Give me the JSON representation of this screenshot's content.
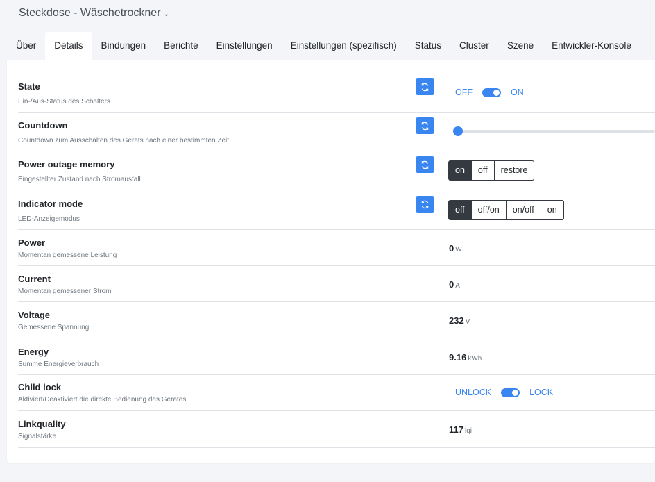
{
  "header": {
    "device_title": "Steckdose - Wäschetrockner"
  },
  "tabs": [
    {
      "label": "Über",
      "active": false
    },
    {
      "label": "Details",
      "active": true
    },
    {
      "label": "Bindungen",
      "active": false
    },
    {
      "label": "Berichte",
      "active": false
    },
    {
      "label": "Einstellungen",
      "active": false
    },
    {
      "label": "Einstellungen (spezifisch)",
      "active": false
    },
    {
      "label": "Status",
      "active": false
    },
    {
      "label": "Cluster",
      "active": false
    },
    {
      "label": "Szene",
      "active": false
    },
    {
      "label": "Entwickler-Konsole",
      "active": false
    }
  ],
  "rows": {
    "state": {
      "label": "State",
      "desc": "Ein-/Aus-Status des Schalters",
      "off_label": "OFF",
      "on_label": "ON",
      "value": "ON"
    },
    "countdown": {
      "label": "Countdown",
      "desc": "Countdown zum Ausschalten des Geräts nach einer bestimmten Zeit",
      "value_fraction": 0
    },
    "power_outage_memory": {
      "label": "Power outage memory",
      "desc": "Eingestellter Zustand nach Stromausfall",
      "options": [
        "on",
        "off",
        "restore"
      ],
      "selected": "on"
    },
    "indicator_mode": {
      "label": "Indicator mode",
      "desc": "LED-Anzeigemodus",
      "options": [
        "off",
        "off/on",
        "on/off",
        "on"
      ],
      "selected": "off"
    },
    "power": {
      "label": "Power",
      "desc": "Momentan gemessene Leistung",
      "value": "0",
      "unit": "W"
    },
    "current": {
      "label": "Current",
      "desc": "Momentan gemessener Strom",
      "value": "0",
      "unit": "A"
    },
    "voltage": {
      "label": "Voltage",
      "desc": "Gemessene Spannung",
      "value": "232",
      "unit": "V"
    },
    "energy": {
      "label": "Energy",
      "desc": "Summe Energieverbrauch",
      "value": "9.16",
      "unit": "kWh"
    },
    "child_lock": {
      "label": "Child lock",
      "desc": "Aktiviert/Deaktiviert die direkte Bedienung des Gerätes",
      "off_label": "UNLOCK",
      "on_label": "LOCK",
      "value": "LOCK"
    },
    "linkquality": {
      "label": "Linkquality",
      "desc": "Signalstärke",
      "value": "117",
      "unit": "lqi"
    }
  },
  "colors": {
    "accent": "#3a86f0",
    "dark": "#343a40",
    "muted": "#6c757d"
  },
  "icons": {
    "refresh": "refresh-icon",
    "caret": "chevron-down-icon"
  }
}
